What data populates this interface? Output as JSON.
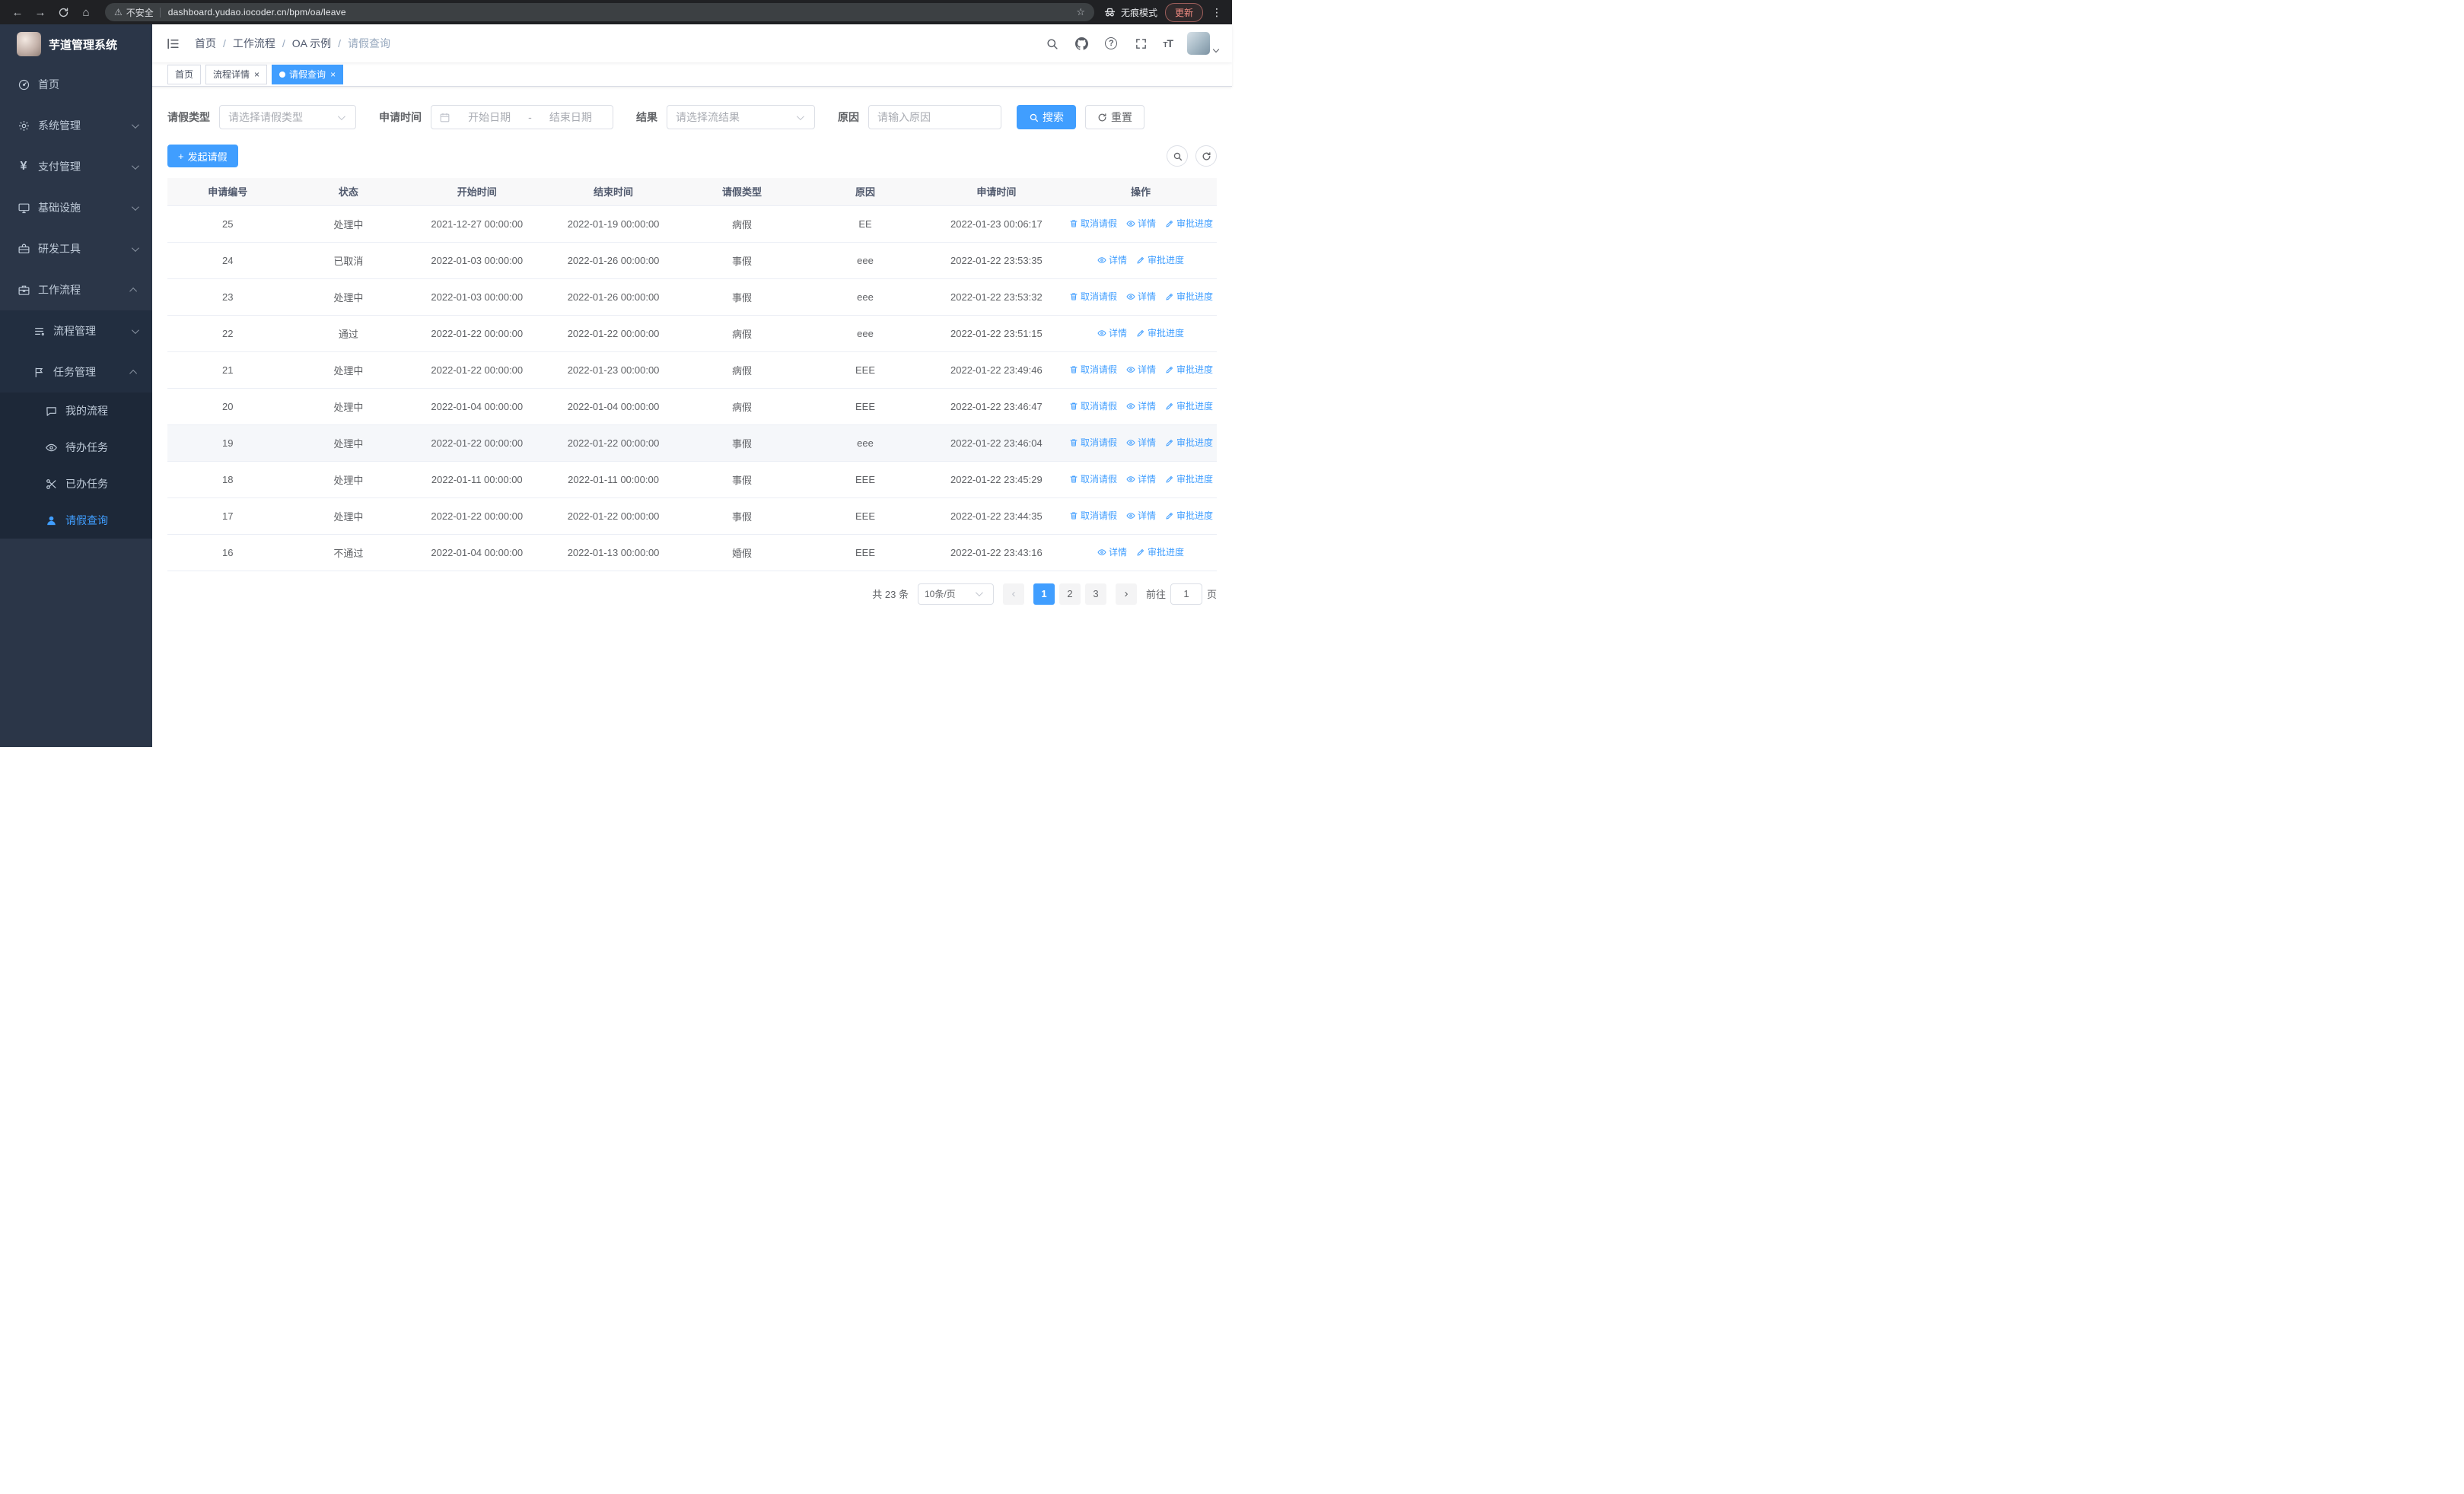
{
  "browser": {
    "security_text": "不安全",
    "url": "dashboard.yudao.iocoder.cn/bpm/oa/leave",
    "incognito_text": "无痕模式",
    "update_text": "更新"
  },
  "sidebar": {
    "title": "芋道管理系统",
    "items": [
      {
        "label": "首页"
      },
      {
        "label": "系统管理"
      },
      {
        "label": "支付管理"
      },
      {
        "label": "基础设施"
      },
      {
        "label": "研发工具"
      },
      {
        "label": "工作流程"
      },
      {
        "label": "流程管理"
      },
      {
        "label": "任务管理"
      },
      {
        "label": "我的流程"
      },
      {
        "label": "待办任务"
      },
      {
        "label": "已办任务"
      },
      {
        "label": "请假查询"
      }
    ]
  },
  "header": {
    "breadcrumb": [
      {
        "label": "首页"
      },
      {
        "label": "工作流程"
      },
      {
        "label": "OA 示例"
      },
      {
        "label": "请假查询"
      }
    ],
    "font_icon_text": "T"
  },
  "tabs": [
    {
      "label": "首页"
    },
    {
      "label": "流程详情"
    },
    {
      "label": "请假查询"
    }
  ],
  "filters": {
    "leave_type_label": "请假类型",
    "leave_type_placeholder": "请选择请假类型",
    "apply_time_label": "申请时间",
    "start_placeholder": "开始日期",
    "range_separator": "-",
    "end_placeholder": "结束日期",
    "result_label": "结果",
    "result_placeholder": "请选择流结果",
    "reason_label": "原因",
    "reason_placeholder": "请输入原因",
    "search_label": "搜索",
    "reset_label": "重置"
  },
  "toolbar": {
    "create_label": "发起请假"
  },
  "table": {
    "columns": [
      "申请编号",
      "状态",
      "开始时间",
      "结束时间",
      "请假类型",
      "原因",
      "申请时间",
      "操作"
    ],
    "action_labels": {
      "cancel": "取消请假",
      "detail": "详情",
      "progress": "审批进度"
    },
    "rows": [
      {
        "id": "25",
        "status": "处理中",
        "start": "2021-12-27 00:00:00",
        "end": "2022-01-19 00:00:00",
        "type": "病假",
        "reason": "EE",
        "applied": "2022-01-23 00:06:17",
        "actions": [
          "cancel",
          "detail",
          "progress"
        ]
      },
      {
        "id": "24",
        "status": "已取消",
        "start": "2022-01-03 00:00:00",
        "end": "2022-01-26 00:00:00",
        "type": "事假",
        "reason": "eee",
        "applied": "2022-01-22 23:53:35",
        "actions": [
          "detail",
          "progress"
        ]
      },
      {
        "id": "23",
        "status": "处理中",
        "start": "2022-01-03 00:00:00",
        "end": "2022-01-26 00:00:00",
        "type": "事假",
        "reason": "eee",
        "applied": "2022-01-22 23:53:32",
        "actions": [
          "cancel",
          "detail",
          "progress"
        ]
      },
      {
        "id": "22",
        "status": "通过",
        "start": "2022-01-22 00:00:00",
        "end": "2022-01-22 00:00:00",
        "type": "病假",
        "reason": "eee",
        "applied": "2022-01-22 23:51:15",
        "actions": [
          "detail",
          "progress"
        ]
      },
      {
        "id": "21",
        "status": "处理中",
        "start": "2022-01-22 00:00:00",
        "end": "2022-01-23 00:00:00",
        "type": "病假",
        "reason": "EEE",
        "applied": "2022-01-22 23:49:46",
        "actions": [
          "cancel",
          "detail",
          "progress"
        ]
      },
      {
        "id": "20",
        "status": "处理中",
        "start": "2022-01-04 00:00:00",
        "end": "2022-01-04 00:00:00",
        "type": "病假",
        "reason": "EEE",
        "applied": "2022-01-22 23:46:47",
        "actions": [
          "cancel",
          "detail",
          "progress"
        ]
      },
      {
        "id": "19",
        "status": "处理中",
        "start": "2022-01-22 00:00:00",
        "end": "2022-01-22 00:00:00",
        "type": "事假",
        "reason": "eee",
        "applied": "2022-01-22 23:46:04",
        "actions": [
          "cancel",
          "detail",
          "progress"
        ],
        "highlighted": true
      },
      {
        "id": "18",
        "status": "处理中",
        "start": "2022-01-11 00:00:00",
        "end": "2022-01-11 00:00:00",
        "type": "事假",
        "reason": "EEE",
        "applied": "2022-01-22 23:45:29",
        "actions": [
          "cancel",
          "detail",
          "progress"
        ]
      },
      {
        "id": "17",
        "status": "处理中",
        "start": "2022-01-22 00:00:00",
        "end": "2022-01-22 00:00:00",
        "type": "事假",
        "reason": "EEE",
        "applied": "2022-01-22 23:44:35",
        "actions": [
          "cancel",
          "detail",
          "progress"
        ]
      },
      {
        "id": "16",
        "status": "不通过",
        "start": "2022-01-04 00:00:00",
        "end": "2022-01-13 00:00:00",
        "type": "婚假",
        "reason": "EEE",
        "applied": "2022-01-22 23:43:16",
        "actions": [
          "detail",
          "progress"
        ]
      }
    ]
  },
  "pagination": {
    "total_text": "共 23 条",
    "page_size_text": "10条/页",
    "pages": [
      "1",
      "2",
      "3"
    ],
    "goto_label": "前往",
    "goto_value": "1",
    "unit_label": "页"
  }
}
